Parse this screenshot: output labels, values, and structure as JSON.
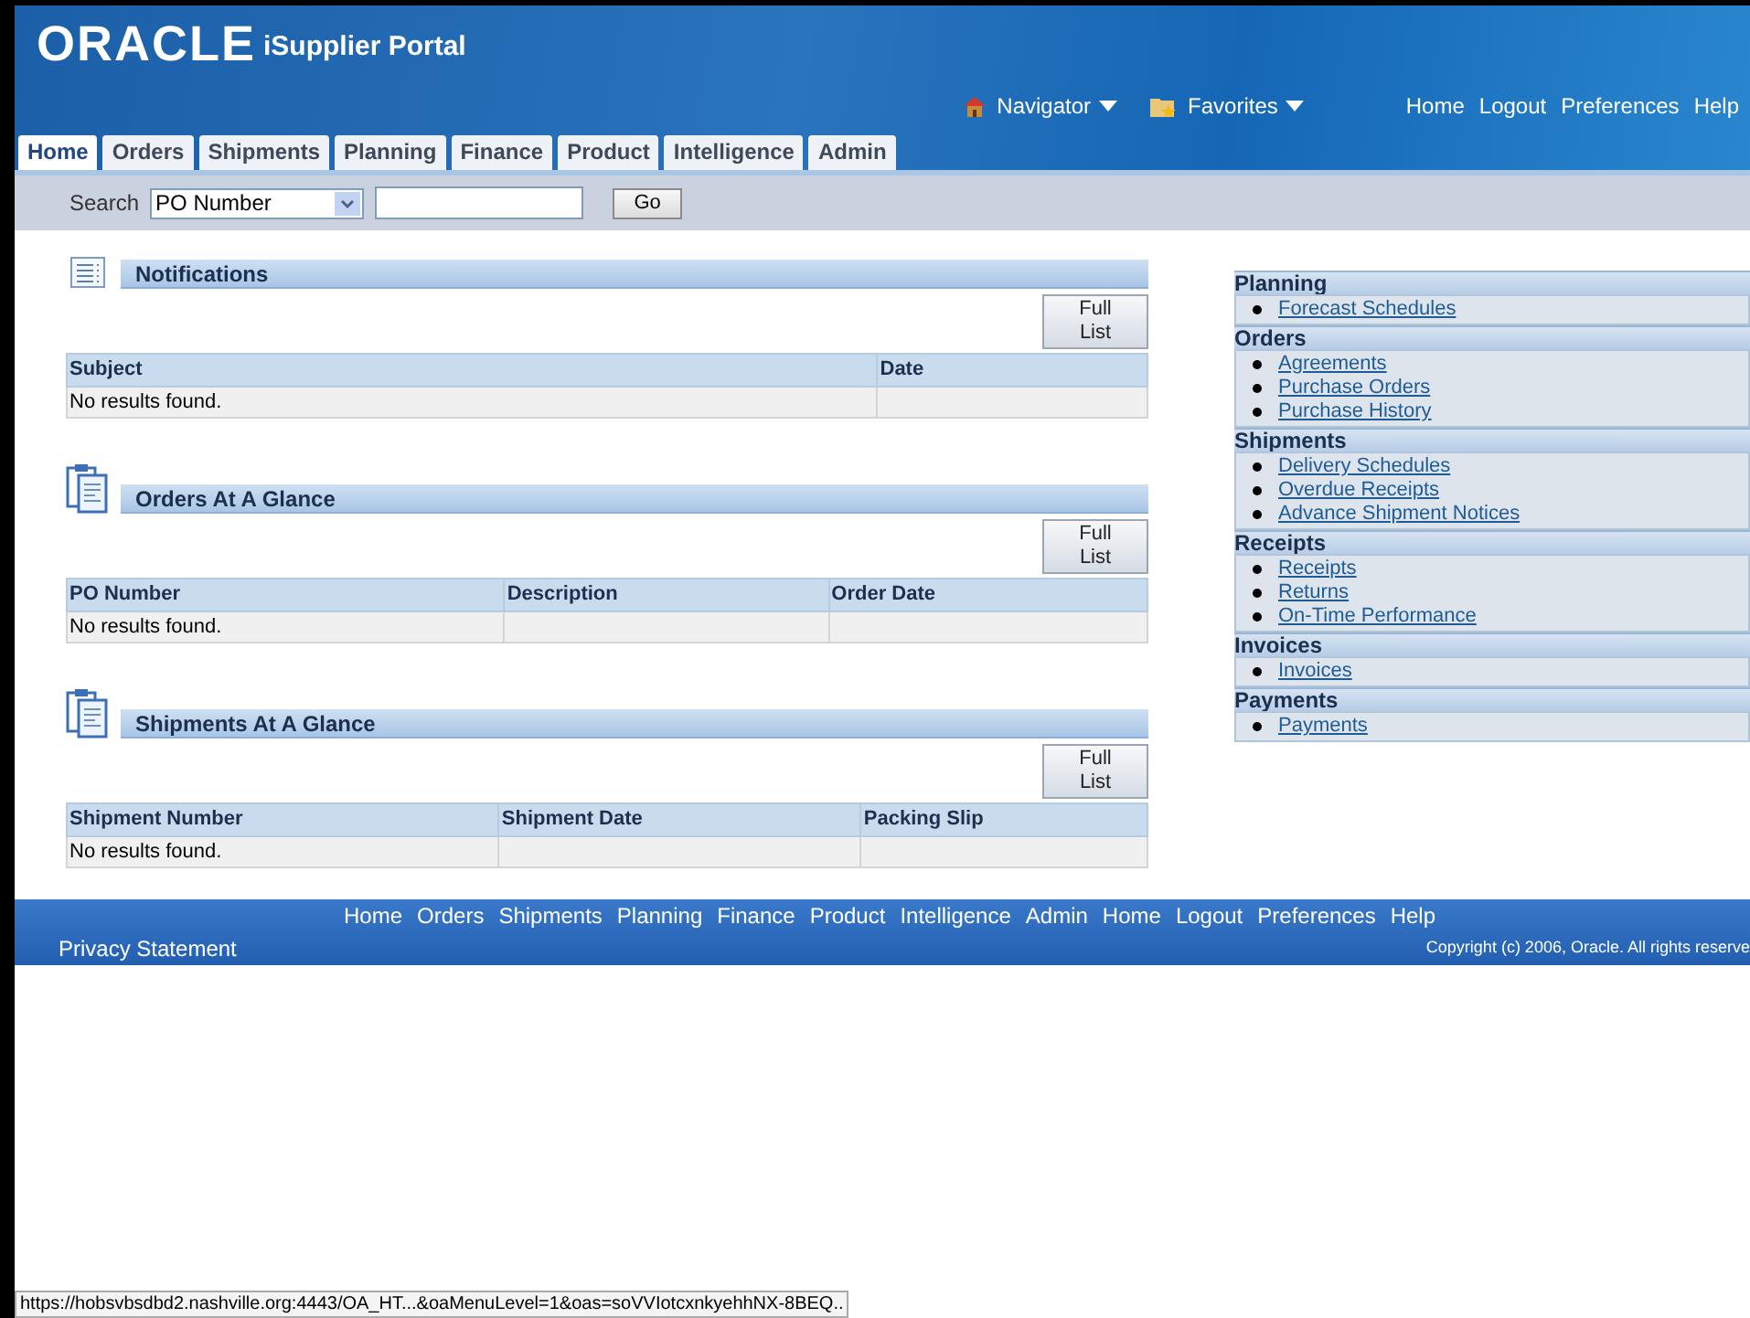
{
  "header": {
    "logo": "ORACLE",
    "product": "iSupplier Portal",
    "navigator": "Navigator",
    "favorites": "Favorites",
    "links": [
      "Home",
      "Logout",
      "Preferences",
      "Help"
    ]
  },
  "tabs": [
    {
      "label": "Home",
      "selected": true
    },
    {
      "label": "Orders",
      "selected": false
    },
    {
      "label": "Shipments",
      "selected": false
    },
    {
      "label": "Planning",
      "selected": false
    },
    {
      "label": "Finance",
      "selected": false
    },
    {
      "label": "Product",
      "selected": false
    },
    {
      "label": "Intelligence",
      "selected": false
    },
    {
      "label": "Admin",
      "selected": false
    }
  ],
  "search": {
    "label": "Search",
    "option": "PO Number",
    "button": "Go"
  },
  "sections": [
    {
      "title": "Notifications",
      "kind": "list",
      "button": "Full List",
      "columns": [
        "Subject",
        "Date"
      ],
      "message": "No results found."
    },
    {
      "title": "Orders At A Glance",
      "kind": "clipboard",
      "button": "Full List",
      "columns": [
        "PO Number",
        "Description",
        "Order Date"
      ],
      "message": "No results found."
    },
    {
      "title": "Shipments At A Glance",
      "kind": "clipboard",
      "button": "Full List",
      "columns": [
        "Shipment Number",
        "Shipment Date",
        "Packing Slip"
      ],
      "message": "No results found."
    }
  ],
  "side_groups": [
    {
      "title": "Planning",
      "links": [
        "Forecast Schedules"
      ]
    },
    {
      "title": "Orders",
      "links": [
        "Agreements",
        "Purchase Orders",
        "Purchase History"
      ]
    },
    {
      "title": "Shipments",
      "links": [
        "Delivery Schedules",
        "Overdue Receipts",
        "Advance Shipment Notices"
      ]
    },
    {
      "title": "Receipts",
      "links": [
        "Receipts",
        "Returns",
        "On-Time Performance"
      ]
    },
    {
      "title": "Invoices",
      "links": [
        "Invoices"
      ]
    },
    {
      "title": "Payments",
      "links": [
        "Payments"
      ]
    }
  ],
  "footer": {
    "links": [
      "Home",
      "Orders",
      "Shipments",
      "Planning",
      "Finance",
      "Product",
      "Intelligence",
      "Admin",
      "Home",
      "Logout",
      "Preferences",
      "Help"
    ],
    "privacy": "Privacy Statement",
    "copyright": "Copyright (c) 2006, Oracle. All rights reserve"
  },
  "status_bar": "https://hobsvbsdbd2.nashville.org:4443/OA_HT...&oaMenuLevel=1&oas=soVVIotcxnkyehhNX-8BEQ.."
}
